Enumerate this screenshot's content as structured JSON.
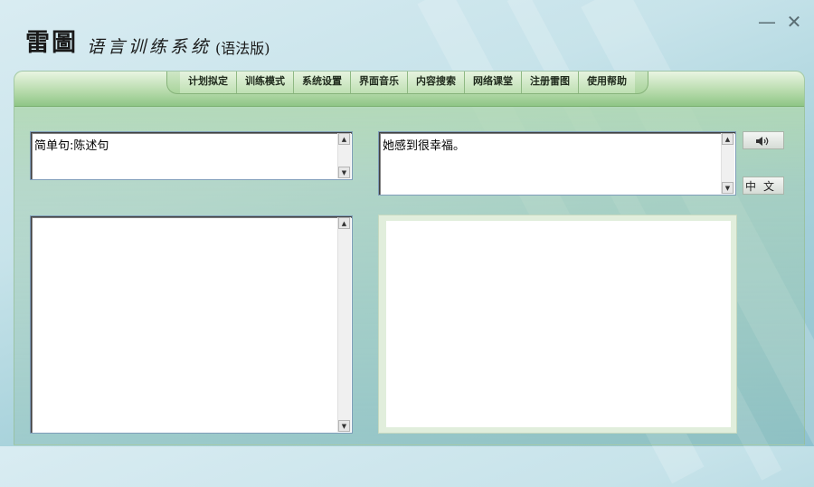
{
  "window": {
    "logo": "雷圖",
    "title": "语言训练系统",
    "edition": "(语法版)",
    "minimize_glyph": "—",
    "close_glyph": "✕"
  },
  "menu": {
    "items": [
      "计划拟定",
      "训练模式",
      "系统设置",
      "界面音乐",
      "内容搜索",
      "网络课堂",
      "注册雷图",
      "使用帮助"
    ]
  },
  "panels": {
    "category_text": "简单句:陈述句",
    "sentence_text": "她感到很幸福。",
    "list_text": "",
    "display_text": ""
  },
  "buttons": {
    "speaker_icon": "speaker-icon",
    "chinese_label": "中文"
  },
  "colors": {
    "menu_green": "#a9d49c",
    "textbox_border": "#7f9db9",
    "display_frame": "#e1eedc"
  }
}
